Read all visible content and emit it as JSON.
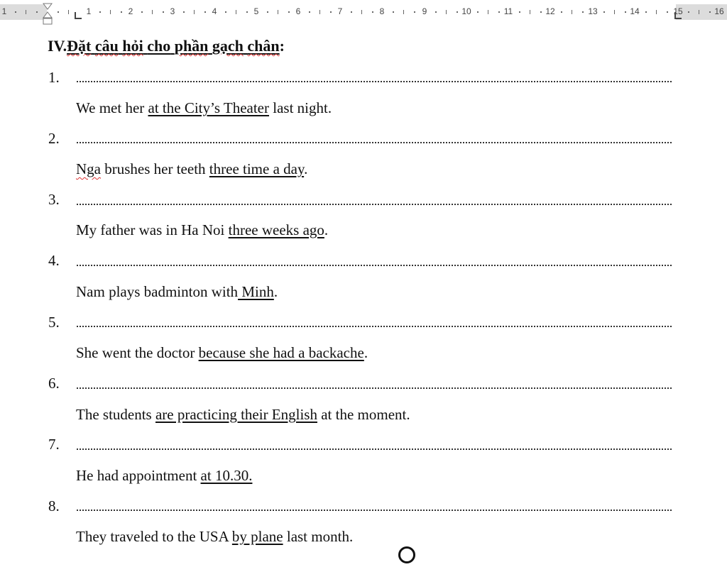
{
  "ruler": {
    "labels": [
      "1",
      "1",
      "2",
      "3",
      "4",
      "5",
      "6",
      "7",
      "8",
      "9",
      "10",
      "11",
      "12",
      "13",
      "14",
      "15",
      "16"
    ]
  },
  "heading": {
    "roman": "IV.",
    "words": [
      "Đặt",
      "câu",
      "hỏi",
      "cho",
      "phần",
      "gạch",
      "chân"
    ],
    "colon": ":"
  },
  "items": [
    {
      "number": "1.",
      "pre": "We met her ",
      "underlined": "at the City’s Theater",
      "post": " last night."
    },
    {
      "number": "2.",
      "pre_sq": "Nga",
      "pre": " brushes her teeth ",
      "underlined": "three time a day",
      "post": "."
    },
    {
      "number": "3.",
      "pre": "My father was in Ha Noi ",
      "underlined": "three weeks ago",
      "post": "."
    },
    {
      "number": "4.",
      "pre": "Nam plays badminton with",
      "underlined": " Minh",
      "post": "."
    },
    {
      "number": "5.",
      "pre": "She went the doctor ",
      "underlined": "because she had a backache",
      "post": "."
    },
    {
      "number": "6.",
      "pre": "The students ",
      "underlined": "are practicing their English",
      "post": " at the moment."
    },
    {
      "number": "7.",
      "pre": "He had appointment ",
      "underlined": "at 10.30.",
      "post": ""
    },
    {
      "number": "8.",
      "pre": "They traveled to the USA ",
      "underlined": "by plane",
      "post": " last month."
    }
  ]
}
